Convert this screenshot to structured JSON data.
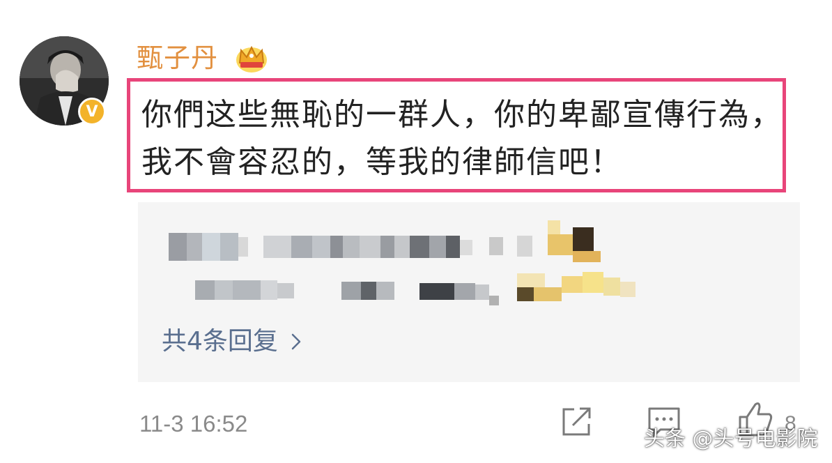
{
  "user": {
    "name": "甄子丹",
    "avatar_icon": "avatar-photo",
    "verified_badge": "V",
    "badge_icon": "crown-icon"
  },
  "comment": {
    "text": "你們这些無恥的一群人，你的卑鄙宣傳行為，我不會容忍的，等我的律師信吧！",
    "highlight_color": "#e8457a"
  },
  "replies": {
    "count_label": "共4条回复",
    "chevron_icon": "chevron-right-icon",
    "obscured": true
  },
  "footer": {
    "timestamp": "11-3 16:52",
    "share_icon": "share-icon",
    "comment_icon": "comment-icon",
    "like_icon": "thumbs-up-icon",
    "like_count": "8"
  },
  "watermark": "头条 @头号电影院",
  "colors": {
    "name": "#e2903f",
    "link": "#5a6f8f",
    "meta": "#8a8a8a",
    "verified": "#f3b32a"
  }
}
